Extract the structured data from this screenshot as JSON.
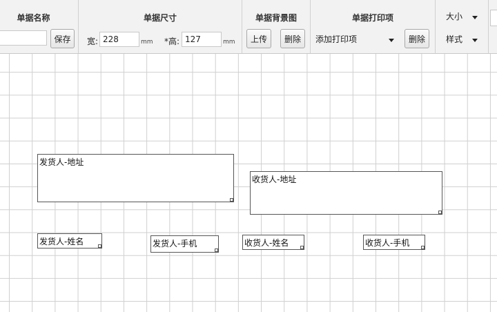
{
  "toolbar": {
    "name_section": {
      "title": "单据名称",
      "name_value": "",
      "save_label": "保存"
    },
    "size_section": {
      "title": "单据尺寸",
      "width_label": "宽:",
      "width_value": "228",
      "width_unit": "mm",
      "height_label": "*高:",
      "height_value": "127",
      "height_unit": "mm"
    },
    "bg_section": {
      "title": "单据背景图",
      "upload_label": "上传",
      "delete_label": "删除"
    },
    "print_section": {
      "title": "单据打印项",
      "select_value": "添加打印项",
      "delete_label": "删除"
    },
    "style_section": {
      "size_select": "大小",
      "style_select": "样式"
    }
  },
  "canvas": {
    "fields": [
      {
        "label": "发货人-地址"
      },
      {
        "label": "收货人-地址"
      },
      {
        "label": "发货人-姓名"
      },
      {
        "label": "发货人-手机"
      },
      {
        "label": "收货人-姓名"
      },
      {
        "label": "收货人-手机"
      }
    ]
  }
}
